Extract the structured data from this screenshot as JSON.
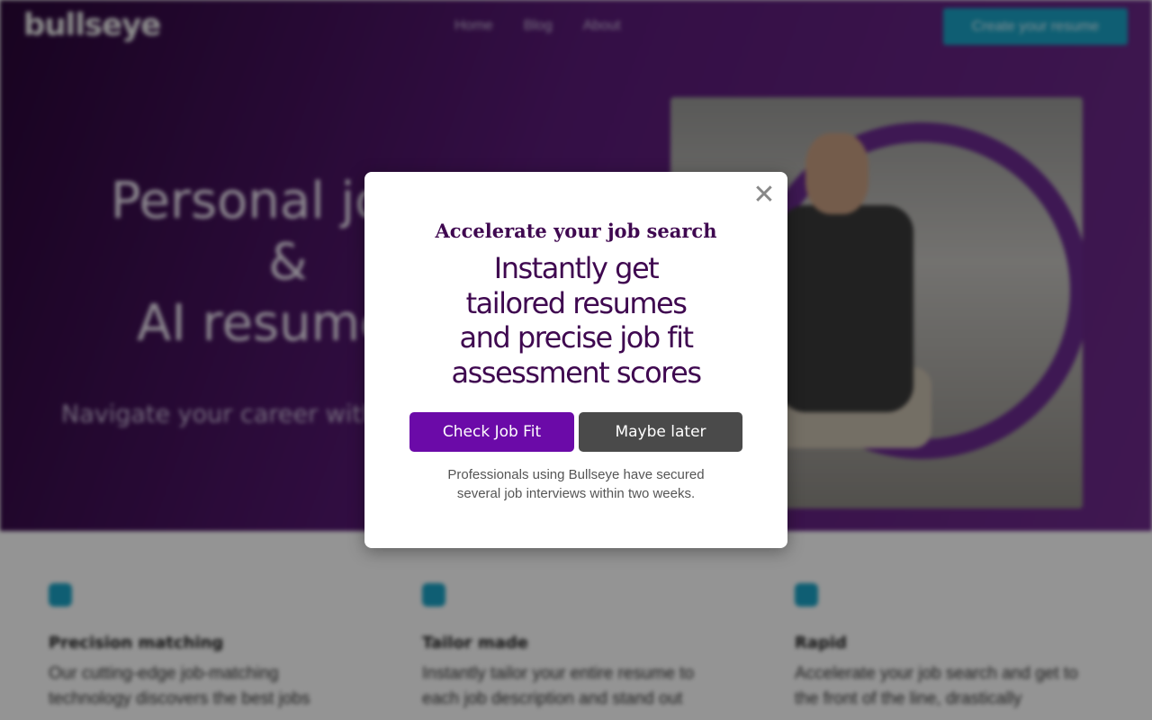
{
  "background": {
    "logo": "bullseye",
    "nav": [
      "Home",
      "Blog",
      "About"
    ],
    "cta_label": "Create your resume",
    "hero_title_line1": "Personal job h",
    "hero_title_line2": "&",
    "hero_title_line3": "AI resume b",
    "hero_subtitle": "Navigate your career with",
    "features": [
      {
        "title": "Precision matching",
        "text": "Our cutting-edge job-matching technology discovers the best jobs"
      },
      {
        "title": "Tailor made",
        "text": "Instantly tailor your entire resume to each job description and stand out"
      },
      {
        "title": "Rapid",
        "text": "Accelerate your job search and get to the front of the line, drastically"
      }
    ]
  },
  "modal": {
    "close_glyph": "✕",
    "eyebrow": "Accelerate your job search",
    "headline_lines": [
      "Instantly get",
      "tailored resumes",
      "and precise job fit",
      "assessment scores"
    ],
    "primary_label": "Check Job Fit",
    "secondary_label": "Maybe later",
    "footnote_lines": [
      "Professionals using Bullseye have secured",
      "several job interviews within two weeks."
    ]
  },
  "colors": {
    "accent_purple": "#6b0aa8",
    "headline_text": "#3f0850",
    "secondary_button": "#4a4a4a",
    "cta_teal": "#1aa3c6"
  }
}
